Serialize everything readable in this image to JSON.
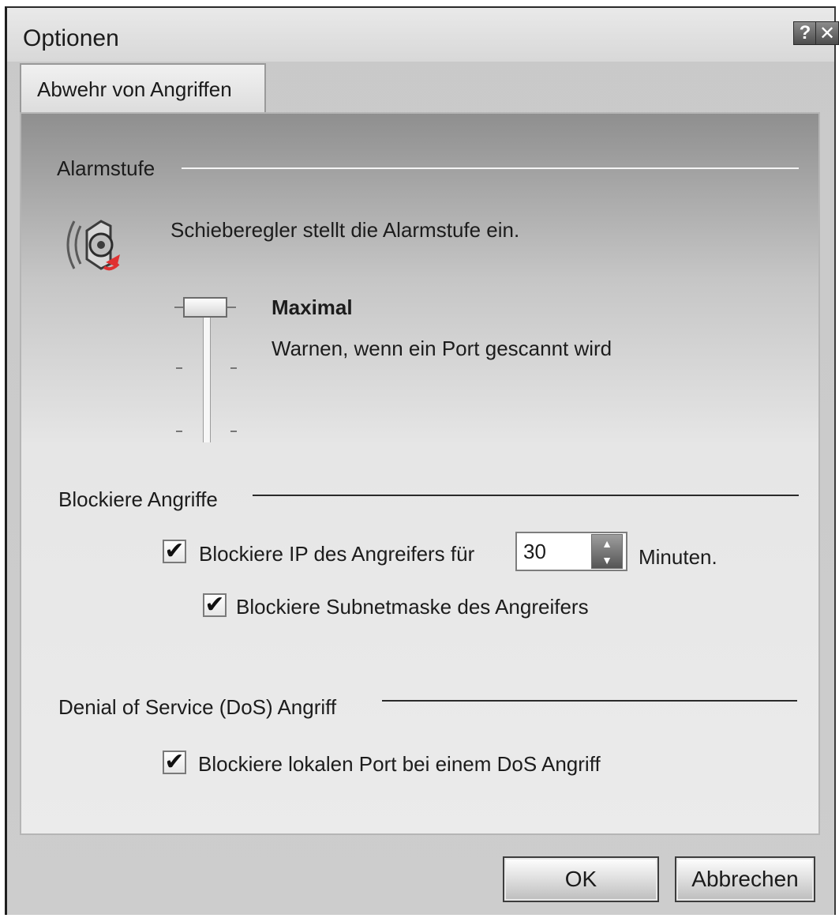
{
  "window": {
    "title": "Optionen",
    "help_label": "?",
    "close_label": "✕"
  },
  "tab": {
    "label": "Abwehr von Angriffen"
  },
  "alarm": {
    "group_label": "Alarmstufe",
    "description": "Schieberegler stellt die Alarmstufe ein.",
    "level_name": "Maximal",
    "level_description": "Warnen, wenn ein Port gescannt wird",
    "slider_level_fraction": 1.0
  },
  "block_attacks": {
    "group_label": "Blockiere Angriffe",
    "block_ip_label": "Blockiere IP des Angreifers für",
    "block_ip_checked": true,
    "minutes_value": "30",
    "minutes_unit": "Minuten.",
    "block_subnet_label": "Blockiere Subnetmaske des Angreifers",
    "block_subnet_checked": true
  },
  "dos": {
    "group_label": "Denial of Service (DoS) Angriff",
    "block_port_label": "Blockiere lokalen Port bei einem DoS Angriff",
    "block_port_checked": true
  },
  "buttons": {
    "ok": "OK",
    "cancel": "Abbrechen"
  },
  "icons": {
    "speaker": "speaker-icon",
    "checkmark": "✔"
  }
}
